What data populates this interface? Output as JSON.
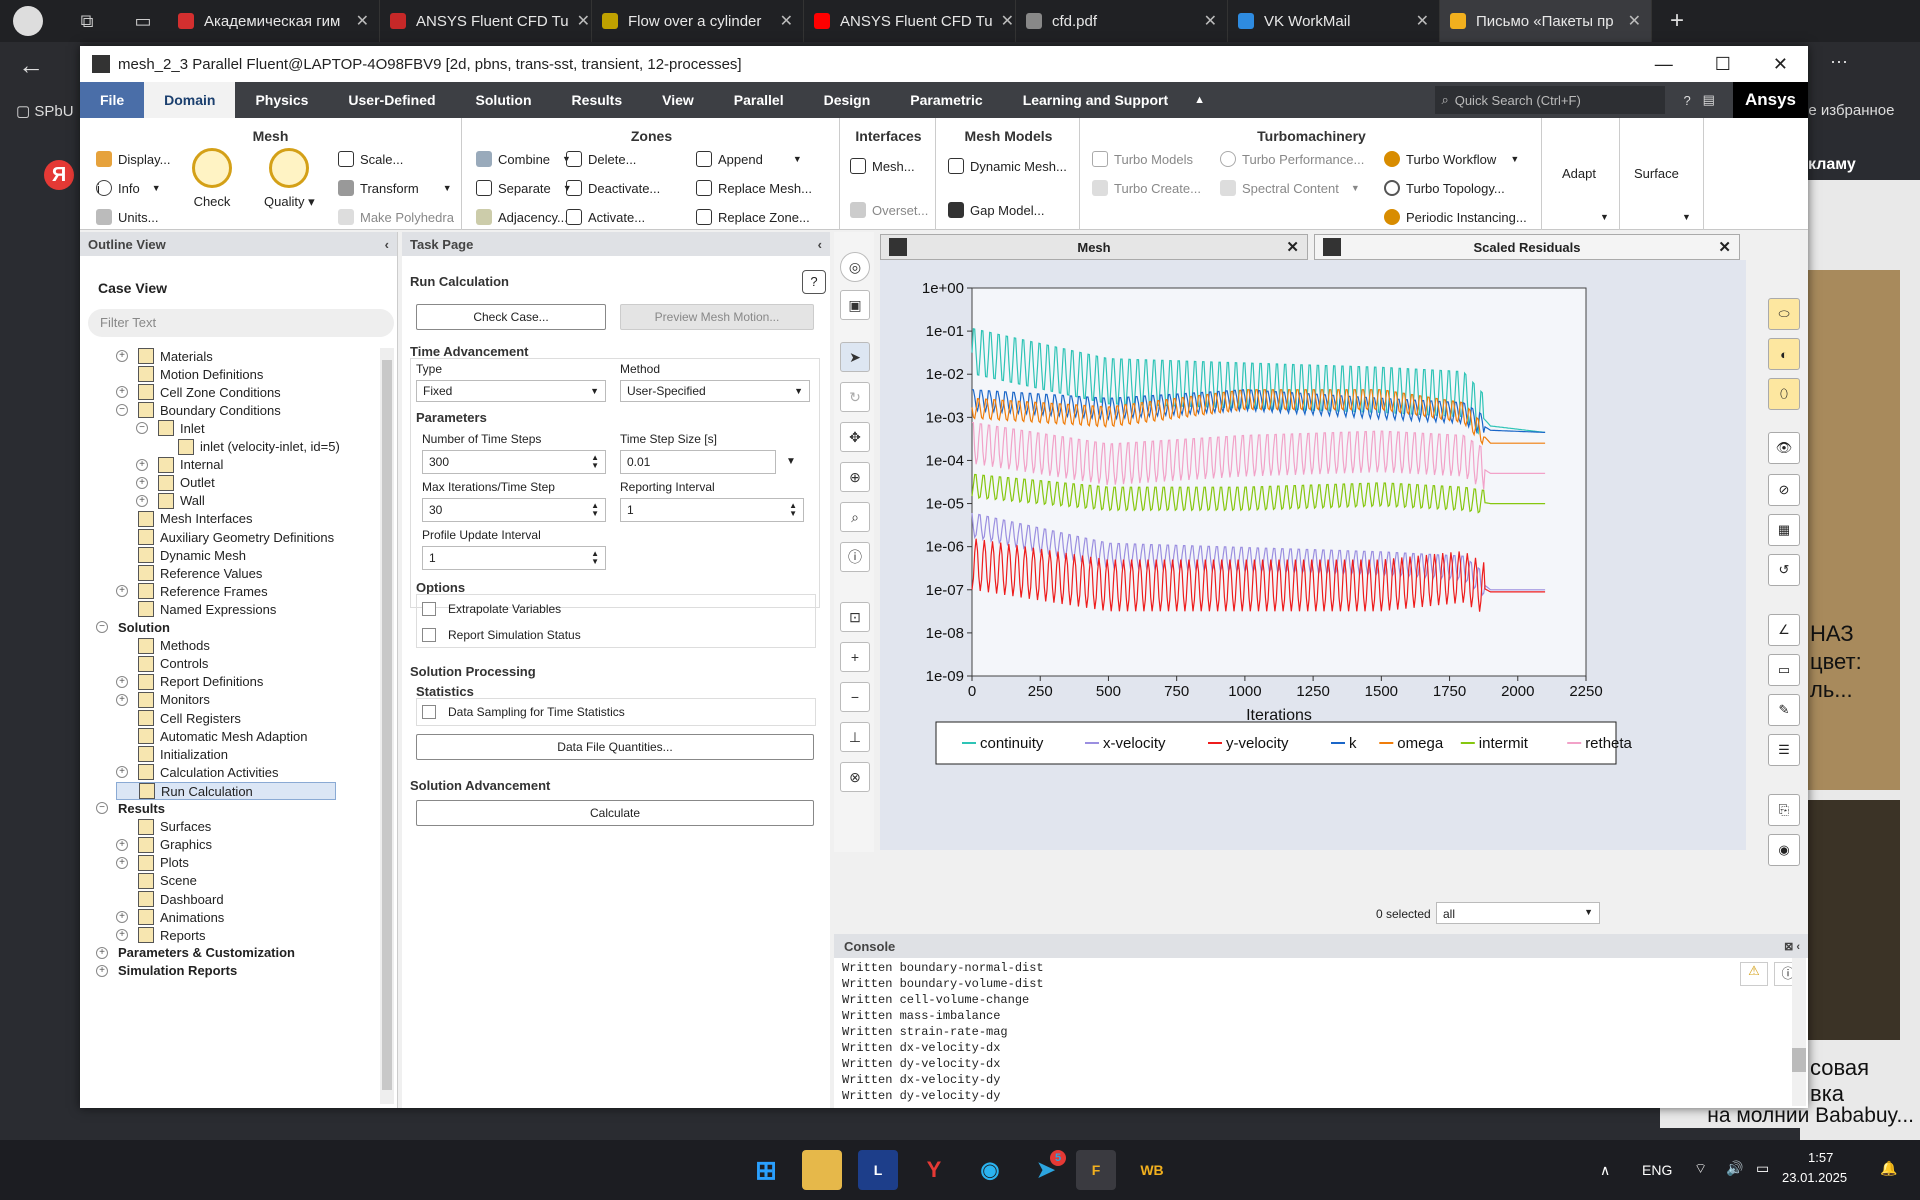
{
  "browser": {
    "tabs": [
      {
        "label": "Академическая гим",
        "color": "#d32f2f"
      },
      {
        "label": "ANSYS Fluent CFD Tu",
        "color": "#c62828"
      },
      {
        "label": "Flow over a cylinder",
        "color": "#bfa100"
      },
      {
        "label": "ANSYS Fluent CFD Tu",
        "color": "#ff0000"
      },
      {
        "label": "cfd.pdf",
        "color": "#888888"
      },
      {
        "label": "VK WorkMail",
        "color": "#2e8be0"
      },
      {
        "label": "Письмо «Пакеты пр",
        "color": "#f2b01e"
      }
    ],
    "bookmark_left": "SPbU",
    "bookmark_right": "ое избранное",
    "bg_ad_top": "кламу",
    "bg_ad_text1": "НАЗ",
    "bg_ad_text2": "цвет:",
    "bg_ad_text3": "ль...",
    "bg_ad_text4": "совая",
    "bg_ad_text5": "вка",
    "bg_ad_text6": "на молнии Bababuy..."
  },
  "window": {
    "title": "mesh_2_3 Parallel Fluent@LAPTOP-4O98FBV9  [2d, pbns, trans-sst, transient, 12-processes]"
  },
  "ribbon_tabs": [
    "File",
    "Domain",
    "Physics",
    "User-Defined",
    "Solution",
    "Results",
    "View",
    "Parallel",
    "Design",
    "Parametric",
    "Learning and Support"
  ],
  "quick_search": "Quick Search (Ctrl+F)",
  "brand": "Ansys",
  "ribbon": {
    "mesh_title": "Mesh",
    "mesh_items": [
      "Display...",
      "Info",
      "Units...",
      "Check",
      "Quality",
      "Scale...",
      "Transform",
      "Make Polyhedra"
    ],
    "zones_title": "Zones",
    "zones_items": [
      "Combine",
      "Separate",
      "Adjacency...",
      "Delete...",
      "Deactivate...",
      "Activate...",
      "Append",
      "Replace Mesh...",
      "Replace Zone..."
    ],
    "interfaces_title": "Interfaces",
    "interfaces_items": [
      "Mesh...",
      "Overset..."
    ],
    "meshmodels_title": "Mesh Models",
    "meshmodels_items": [
      "Dynamic Mesh...",
      "Gap Model..."
    ],
    "turbo_title": "Turbomachinery",
    "turbo_items": [
      "Turbo Models",
      "Turbo Create...",
      "Turbo Performance...",
      "Spectral Content",
      "Turbo Workflow",
      "Turbo Topology...",
      "Periodic Instancing..."
    ],
    "adapt": "Adapt",
    "surface": "Surface"
  },
  "outline": {
    "title": "Outline View",
    "caseview": "Case View",
    "filter_placeholder": "Filter Text",
    "nodes": [
      {
        "label": "Materials",
        "indent": 1,
        "exp": "+"
      },
      {
        "label": "Motion Definitions",
        "indent": 1,
        "exp": ""
      },
      {
        "label": "Cell Zone Conditions",
        "indent": 1,
        "exp": "+"
      },
      {
        "label": "Boundary Conditions",
        "indent": 1,
        "exp": "−"
      },
      {
        "label": "Inlet",
        "indent": 2,
        "exp": "−"
      },
      {
        "label": "inlet (velocity-inlet, id=5)",
        "indent": 3,
        "exp": ""
      },
      {
        "label": "Internal",
        "indent": 2,
        "exp": "+"
      },
      {
        "label": "Outlet",
        "indent": 2,
        "exp": "+"
      },
      {
        "label": "Wall",
        "indent": 2,
        "exp": "+"
      },
      {
        "label": "Mesh Interfaces",
        "indent": 1,
        "exp": ""
      },
      {
        "label": "Auxiliary Geometry Definitions",
        "indent": 1,
        "exp": ""
      },
      {
        "label": "Dynamic Mesh",
        "indent": 1,
        "exp": ""
      },
      {
        "label": "Reference Values",
        "indent": 1,
        "exp": ""
      },
      {
        "label": "Reference Frames",
        "indent": 1,
        "exp": "+"
      },
      {
        "label": "Named Expressions",
        "indent": 1,
        "exp": ""
      },
      {
        "label": "Solution",
        "indent": 0,
        "exp": "−",
        "bold": true
      },
      {
        "label": "Methods",
        "indent": 1,
        "exp": ""
      },
      {
        "label": "Controls",
        "indent": 1,
        "exp": ""
      },
      {
        "label": "Report Definitions",
        "indent": 1,
        "exp": "+"
      },
      {
        "label": "Monitors",
        "indent": 1,
        "exp": "+"
      },
      {
        "label": "Cell Registers",
        "indent": 1,
        "exp": ""
      },
      {
        "label": "Automatic Mesh Adaption",
        "indent": 1,
        "exp": ""
      },
      {
        "label": "Initialization",
        "indent": 1,
        "exp": ""
      },
      {
        "label": "Calculation Activities",
        "indent": 1,
        "exp": "+"
      },
      {
        "label": "Run Calculation",
        "indent": 1,
        "exp": "",
        "selected": true
      },
      {
        "label": "Results",
        "indent": 0,
        "exp": "−",
        "bold": true
      },
      {
        "label": "Surfaces",
        "indent": 1,
        "exp": ""
      },
      {
        "label": "Graphics",
        "indent": 1,
        "exp": "+"
      },
      {
        "label": "Plots",
        "indent": 1,
        "exp": "+"
      },
      {
        "label": "Scene",
        "indent": 1,
        "exp": ""
      },
      {
        "label": "Dashboard",
        "indent": 1,
        "exp": ""
      },
      {
        "label": "Animations",
        "indent": 1,
        "exp": "+"
      },
      {
        "label": "Reports",
        "indent": 1,
        "exp": "+"
      },
      {
        "label": "Parameters & Customization",
        "indent": 0,
        "exp": "+",
        "bold": true
      },
      {
        "label": "Simulation Reports",
        "indent": 0,
        "exp": "+",
        "bold": true
      }
    ]
  },
  "task": {
    "title": "Task Page",
    "heading": "Run Calculation",
    "check_case": "Check Case...",
    "preview_mesh": "Preview Mesh Motion...",
    "time_advancement": "Time Advancement",
    "type_label": "Type",
    "type_value": "Fixed",
    "method_label": "Method",
    "method_value": "User-Specified",
    "parameters": "Parameters",
    "n_steps_label": "Number of Time Steps",
    "n_steps": "300",
    "dt_label": "Time Step Size [s]",
    "dt": "0.01",
    "max_iter_label": "Max Iterations/Time Step",
    "max_iter": "30",
    "report_int_label": "Reporting Interval",
    "report_int": "1",
    "profile_label": "Profile Update Interval",
    "profile": "1",
    "options": "Options",
    "extrapolate": "Extrapolate Variables",
    "report_status": "Report Simulation Status",
    "sol_processing": "Solution Processing",
    "statistics": "Statistics",
    "data_sampling": "Data Sampling for Time Statistics",
    "data_file": "Data File Quantities...",
    "sol_advancement": "Solution Advancement",
    "calculate": "Calculate"
  },
  "graphics_tabs": {
    "mesh": "Mesh",
    "residuals": "Scaled Residuals"
  },
  "selection": {
    "count": "0 selected",
    "filter": "all"
  },
  "console": {
    "title": "Console",
    "lines": [
      "Written boundary-normal-dist",
      "Written boundary-volume-dist",
      "Written cell-volume-change",
      "Written mass-imbalance",
      "Written strain-rate-mag",
      "Written dx-velocity-dx",
      "Written dy-velocity-dx",
      "Written dx-velocity-dy",
      "Written dy-velocity-dy"
    ]
  },
  "chart_data": {
    "type": "line",
    "xlabel": "Iterations",
    "ylabel": "",
    "xlim": [
      0,
      2250
    ],
    "ylim_log10": [
      -9,
      0
    ],
    "xticks": [
      "0",
      "250",
      "500",
      "750",
      "1000",
      "1250",
      "1500",
      "1750",
      "2000",
      "2250"
    ],
    "yticks": [
      "1e+00",
      "1e-01",
      "1e-02",
      "1e-03",
      "1e-04",
      "1e-05",
      "1e-06",
      "1e-07",
      "1e-08",
      "1e-09"
    ],
    "legend_position": "bottom",
    "series": [
      {
        "name": "continuity",
        "color": "#2ec4b6",
        "trend": [
          [
            0,
            -1.5
          ],
          [
            500,
            -2.2
          ],
          [
            1000,
            -2.3
          ],
          [
            1500,
            -2.4
          ],
          [
            1800,
            -2.5
          ],
          [
            1900,
            -3.2
          ],
          [
            2100,
            -3.35
          ]
        ],
        "amp": 0.7
      },
      {
        "name": "x-velocity",
        "color": "#9b8fe0",
        "trend": [
          [
            0,
            -5.5
          ],
          [
            500,
            -6.2
          ],
          [
            1000,
            -6.3
          ],
          [
            1500,
            -6.4
          ],
          [
            1800,
            -6.5
          ],
          [
            1900,
            -7.0
          ],
          [
            2100,
            -7.0
          ]
        ],
        "amp": 0.35
      },
      {
        "name": "y-velocity",
        "color": "#ee1c1c",
        "trend": [
          [
            0,
            -6.4
          ],
          [
            500,
            -6.9
          ],
          [
            1000,
            -6.9
          ],
          [
            1500,
            -6.9
          ],
          [
            1800,
            -6.7
          ],
          [
            1900,
            -7.05
          ],
          [
            2100,
            -7.05
          ]
        ],
        "amp": 0.75
      },
      {
        "name": "k",
        "color": "#1a66c8",
        "trend": [
          [
            0,
            -2.6
          ],
          [
            500,
            -2.8
          ],
          [
            1000,
            -2.6
          ],
          [
            1500,
            -2.8
          ],
          [
            1800,
            -2.9
          ],
          [
            1900,
            -3.3
          ],
          [
            2100,
            -3.35
          ]
        ],
        "amp": 0.3
      },
      {
        "name": "omega",
        "color": "#f07d0a",
        "trend": [
          [
            0,
            -2.8
          ],
          [
            500,
            -3.0
          ],
          [
            1000,
            -2.6
          ],
          [
            1500,
            -2.6
          ],
          [
            1800,
            -2.9
          ],
          [
            1900,
            -3.6
          ],
          [
            2100,
            -3.6
          ]
        ],
        "amp": 0.3
      },
      {
        "name": "intermit",
        "color": "#86c70f",
        "trend": [
          [
            0,
            -4.6
          ],
          [
            500,
            -4.9
          ],
          [
            1000,
            -4.9
          ],
          [
            1500,
            -4.8
          ],
          [
            1800,
            -4.9
          ],
          [
            1900,
            -5.0
          ],
          [
            2100,
            -5.0
          ]
        ],
        "amp": 0.35
      },
      {
        "name": "retheta",
        "color": "#f2a2c8",
        "trend": [
          [
            0,
            -3.6
          ],
          [
            500,
            -4.1
          ],
          [
            1000,
            -3.9
          ],
          [
            1500,
            -3.8
          ],
          [
            1800,
            -3.9
          ],
          [
            1900,
            -4.3
          ],
          [
            2100,
            -4.3
          ]
        ],
        "amp": 0.6
      }
    ]
  },
  "taskbar": {
    "lang": "ENG",
    "time": "1:57",
    "date": "23.01.2025",
    "badge": "5"
  }
}
